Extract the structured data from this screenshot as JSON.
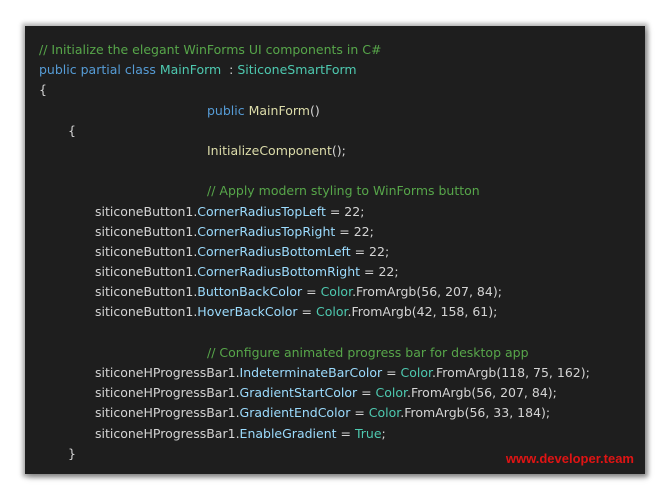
{
  "code": {
    "comment_header": "// Initialize the elegant WinForms UI components in C#",
    "kw_public": "public",
    "kw_partial": "partial",
    "kw_class": "class",
    "class_name": "MainForm",
    "colon": ":",
    "base_class": "SiticoneSmartForm",
    "brace_open": "{",
    "brace_close": "}",
    "ctor_name": "MainForm",
    "ctor_parens": "()",
    "init_call": "InitializeComponent",
    "init_tail": "();",
    "comment_button": "// Apply modern styling to WinForms button",
    "comment_progress": "// Configure animated progress bar for desktop app",
    "button_obj": "siticoneButton1.",
    "progress_obj": "siticoneHProgressBar1.",
    "color_type": "Color",
    "from_argb": ".FromArgb",
    "button_props": [
      {
        "name": "CornerRadiusTopLeft",
        "value": " = 22;"
      },
      {
        "name": "CornerRadiusTopRight",
        "value": " = 22;"
      },
      {
        "name": "CornerRadiusBottomLeft",
        "value": " = 22;"
      },
      {
        "name": "CornerRadiusBottomRight",
        "value": " = 22;"
      },
      {
        "name": "ButtonBackColor",
        "args": "(56, 207, 84);"
      },
      {
        "name": "HoverBackColor",
        "args": "(42, 158, 61);"
      }
    ],
    "progress_props": [
      {
        "name": "IndeterminateBarColor",
        "args": "(118, 75, 162);"
      },
      {
        "name": "GradientStartColor",
        "args": "(56, 207, 84);"
      },
      {
        "name": "GradientEndColor",
        "args": "(56, 33, 184);"
      },
      {
        "name": "EnableGradient",
        "value": " = ",
        "value_type": "True",
        "tail": ";"
      }
    ],
    "equals": " = "
  },
  "watermark": "www.developer.team",
  "colors": {
    "background": "#1e1e1e",
    "comment": "#57a64a",
    "keyword": "#569cd6",
    "type": "#4ec9b0",
    "method": "#dcdcaa",
    "property": "#9cdcfe",
    "watermark": "#e01414"
  }
}
